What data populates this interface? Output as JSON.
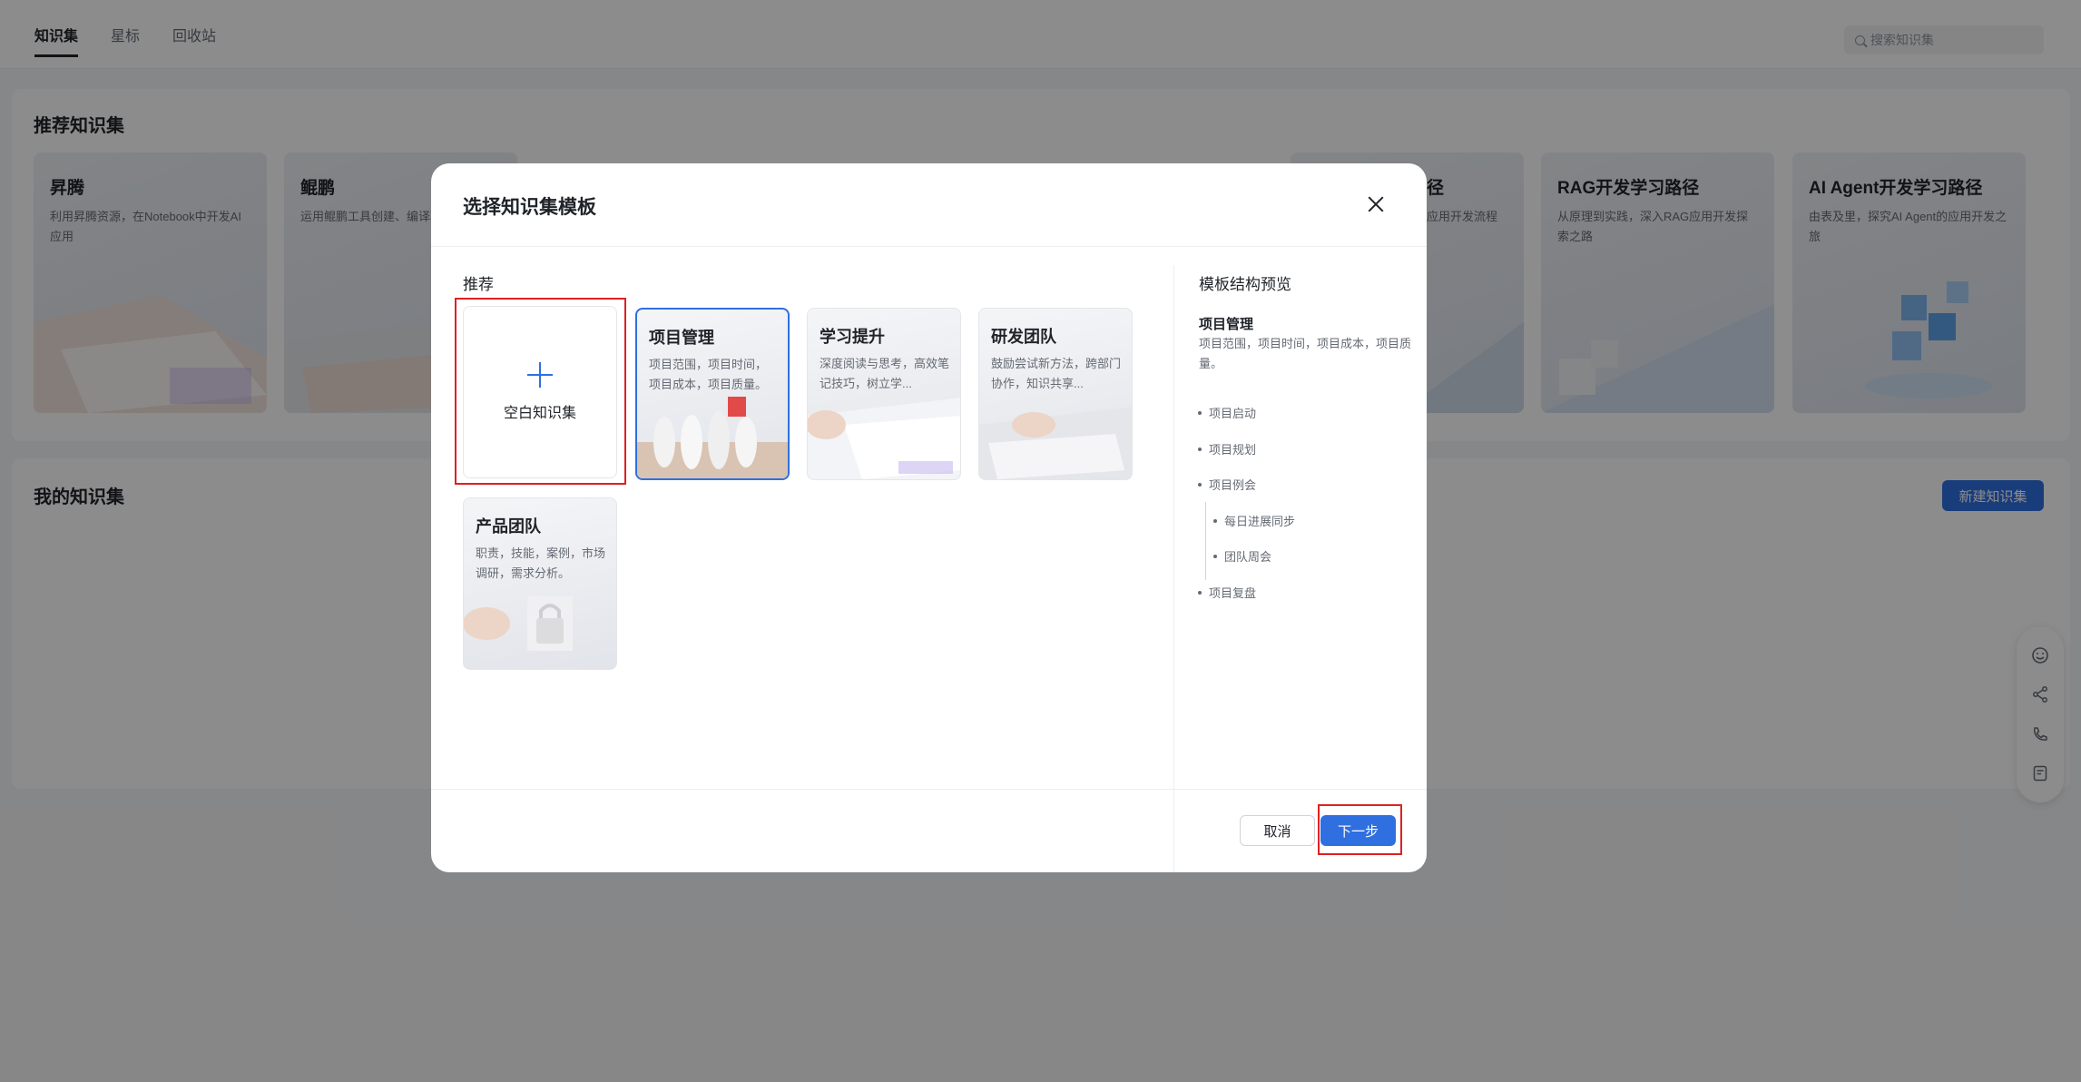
{
  "topbar": {
    "tabs": [
      "知识集",
      "星标",
      "回收站"
    ],
    "search_placeholder": "搜索知识集"
  },
  "recommended": {
    "title": "推荐知识集",
    "cards": [
      {
        "title": "昇腾",
        "desc": "利用昇腾资源，在Notebook中开发AI应用"
      },
      {
        "title": "鲲鹏",
        "desc": "运用鲲鹏工具创建、编译项目"
      },
      {
        "title": "径",
        "desc": "应用开发流程"
      },
      {
        "title": "RAG开发学习路径",
        "desc": "从原理到实践，深入RAG应用开发探索之路"
      },
      {
        "title": "AI Agent开发学习路径",
        "desc": "由表及里，探究AI Agent的应用开发之旅"
      }
    ]
  },
  "mine": {
    "title": "我的知识集",
    "new_button": "新建知识集"
  },
  "floatbar": {
    "icons": [
      "smile-icon",
      "share-icon",
      "phone-icon",
      "note-icon"
    ]
  },
  "dialog": {
    "title": "选择知识集模板",
    "section_label": "推荐",
    "blank_label": "空白知识集",
    "templates": [
      {
        "title": "项目管理",
        "desc": "项目范围，项目时间，项目成本，项目质量。"
      },
      {
        "title": "学习提升",
        "desc": "深度阅读与思考，高效笔记技巧，树立学..."
      },
      {
        "title": "研发团队",
        "desc": "鼓励尝试新方法，跨部门协作，知识共享..."
      },
      {
        "title": "产品团队",
        "desc": "职责，技能，案例，市场调研，需求分析。"
      }
    ],
    "preview": {
      "title": "模板结构预览",
      "name": "项目管理",
      "desc": "项目范围，项目时间，项目成本，项目质量。",
      "items": [
        "项目启动",
        "项目规划",
        "项目例会",
        "每日进展同步",
        "团队周会",
        "项目复盘"
      ]
    },
    "cancel_label": "取消",
    "next_label": "下一步"
  },
  "colors": {
    "accent": "#2f6fe0",
    "highlight": "#e02020"
  }
}
